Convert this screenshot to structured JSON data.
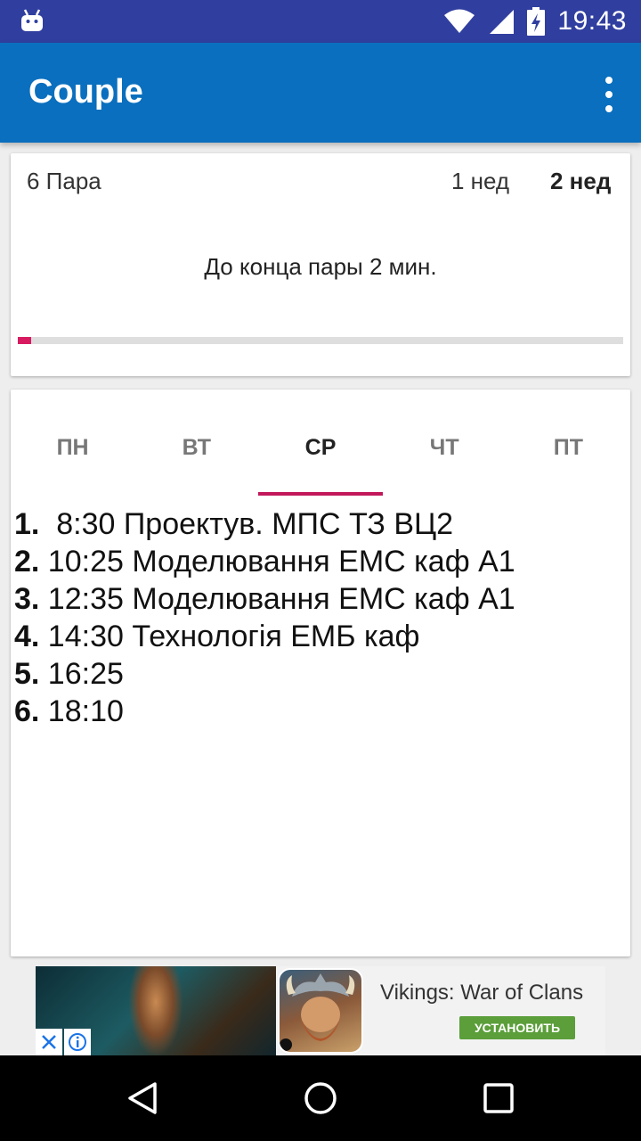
{
  "status_bar": {
    "time": "19:43",
    "icons": [
      "android-notification-icon",
      "wifi-icon",
      "signal-icon",
      "battery-charging-icon"
    ]
  },
  "app_bar": {
    "title": "Couple",
    "menu_icon": "overflow-menu-icon"
  },
  "current": {
    "lesson": "6 Пара",
    "week1_label": "1 нед",
    "week2_label": "2 нед",
    "active_week": "2 нед",
    "remaining_text": "До конца пары 2 мин.",
    "progress_fraction": 0.022
  },
  "tabs": [
    {
      "label": "ПН",
      "active": false
    },
    {
      "label": "ВТ",
      "active": false
    },
    {
      "label": "СР",
      "active": true
    },
    {
      "label": "ЧТ",
      "active": false
    },
    {
      "label": "ПТ",
      "active": false
    }
  ],
  "schedule": [
    {
      "num": "1.",
      "text": "  8:30 Проектув. МПС ТЗ ВЦ2"
    },
    {
      "num": "2.",
      "text": " 10:25 Моделювання ЕМС каф А1"
    },
    {
      "num": "3.",
      "text": " 12:35 Моделювання ЕМС каф А1"
    },
    {
      "num": "4.",
      "text": " 14:30 Технологія ЕМБ каф"
    },
    {
      "num": "5.",
      "text": " 16:25"
    },
    {
      "num": "6.",
      "text": " 18:10"
    }
  ],
  "ad": {
    "app_name": "Vikings: War of Clans",
    "install_label": "УСТАНОВИТЬ"
  },
  "nav": {
    "back_icon": "back-triangle-icon",
    "home_icon": "home-circle-icon",
    "recents_icon": "recents-square-icon"
  },
  "colors": {
    "status_bar": "#303f9f",
    "app_bar": "#0a6fbe",
    "accent": "#c2185b",
    "progress": "#d81b60",
    "install_button": "#5b9e3a"
  }
}
